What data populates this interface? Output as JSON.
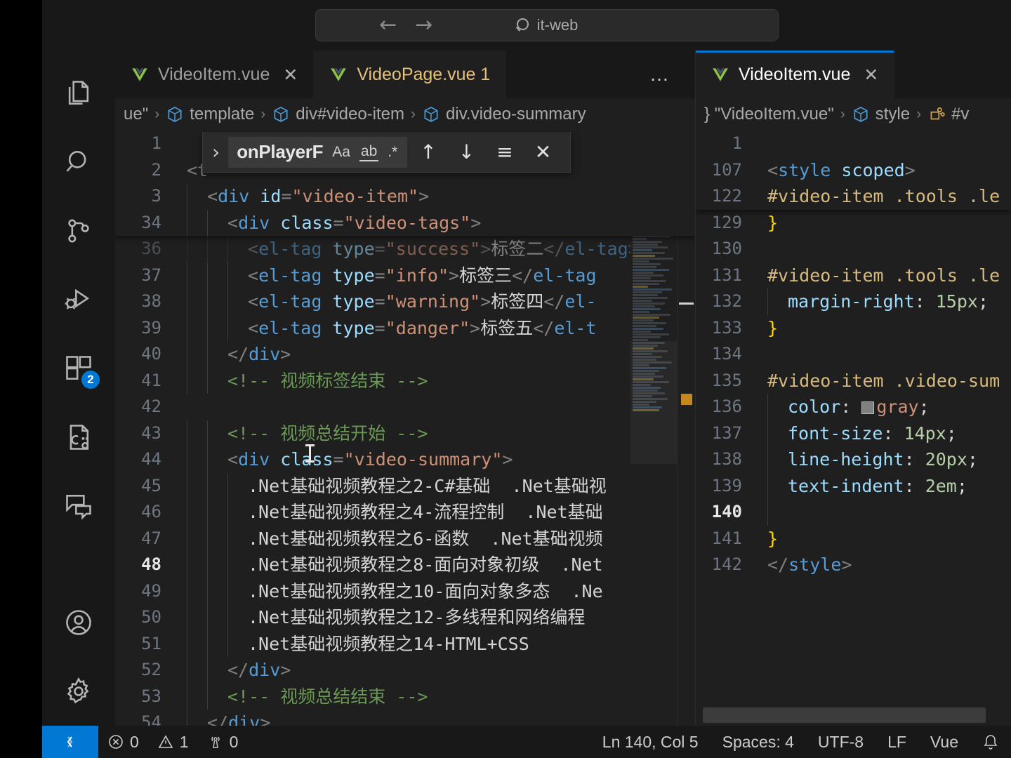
{
  "titlebar": {
    "back_icon": "arrow-left-icon",
    "forward_icon": "arrow-right-icon",
    "back_glyph": "←",
    "forward_glyph": "→",
    "search_placeholder": "it-web",
    "search_value": "it-web",
    "search_icon": "search-icon"
  },
  "activitybar": {
    "items": [
      {
        "name": "explorer",
        "icon": "files-icon",
        "badge": ""
      },
      {
        "name": "search",
        "icon": "search-icon",
        "badge": ""
      },
      {
        "name": "source-control",
        "icon": "source-control-icon",
        "badge": ""
      },
      {
        "name": "run-and-debug",
        "icon": "run-debug-icon",
        "badge": ""
      },
      {
        "name": "extensions",
        "icon": "extensions-icon",
        "badge": "2"
      },
      {
        "name": "remote-explorer",
        "icon": "cpp-config-icon",
        "badge": ""
      },
      {
        "name": "chat",
        "icon": "chat-icon",
        "badge": ""
      }
    ],
    "bottom": [
      {
        "name": "accounts",
        "icon": "account-icon"
      },
      {
        "name": "manage",
        "icon": "gear-icon"
      }
    ],
    "extensions_badge": "2"
  },
  "left_pane": {
    "tabs": [
      {
        "label": "VideoItem.vue",
        "icon": "vue-icon",
        "close": "✕",
        "active": false,
        "modified": false
      },
      {
        "label": "VideoPage.vue 1",
        "icon": "vue-icon",
        "close": "",
        "active": true,
        "modified": true
      }
    ],
    "more_actions": "…",
    "breadcrumb": [
      {
        "label": "ue\"",
        "icon": ""
      },
      {
        "label": "template",
        "icon": "symbol-cube-icon"
      },
      {
        "label": "div#video-item",
        "icon": "symbol-cube-icon"
      },
      {
        "label": "div.video-summary",
        "icon": "symbol-cube-icon"
      }
    ],
    "breadcrumb_sep": "›",
    "find": {
      "expand_icon": "chevron-right-icon",
      "query": "onPlayerF",
      "match_case_label": "Aa",
      "whole_word_label": "ab",
      "regex_label": ".*",
      "prev_glyph": "↑",
      "next_glyph": "↓",
      "find_in_selection_glyph": "≡",
      "close_glyph": "✕"
    },
    "sticky_lines": [
      {
        "num": "1",
        "indent": 0,
        "code": []
      },
      {
        "num": "2",
        "indent": 0,
        "code": [
          {
            "t": "punct",
            "s": "<t"
          }
        ]
      },
      {
        "num": "3",
        "indent": 1,
        "code": [
          {
            "t": "punct",
            "s": "<"
          },
          {
            "t": "tag",
            "s": "div"
          },
          {
            "t": "text",
            "s": " "
          },
          {
            "t": "attr",
            "s": "id"
          },
          {
            "t": "punct",
            "s": "="
          },
          {
            "t": "str",
            "s": "\"video-item\""
          },
          {
            "t": "punct",
            "s": ">"
          }
        ]
      },
      {
        "num": "34",
        "indent": 2,
        "code": [
          {
            "t": "punct",
            "s": "<"
          },
          {
            "t": "tag",
            "s": "div"
          },
          {
            "t": "text",
            "s": " "
          },
          {
            "t": "attr",
            "s": "class"
          },
          {
            "t": "punct",
            "s": "="
          },
          {
            "t": "str",
            "s": "\"video-tags\""
          },
          {
            "t": "punct",
            "s": ">"
          }
        ]
      }
    ],
    "lines": [
      {
        "num": "36",
        "indent": 3,
        "cut": true,
        "code": [
          {
            "t": "punct",
            "s": "<"
          },
          {
            "t": "tag",
            "s": "el-tag"
          },
          {
            "t": "text",
            "s": " "
          },
          {
            "t": "attr",
            "s": "type"
          },
          {
            "t": "punct",
            "s": "="
          },
          {
            "t": "str",
            "s": "\"success\""
          },
          {
            "t": "punct",
            "s": ">"
          },
          {
            "t": "text",
            "s": "标签二"
          },
          {
            "t": "punct",
            "s": "</"
          },
          {
            "t": "tag",
            "s": "el-tag"
          },
          {
            "t": "punct",
            "s": ">"
          }
        ]
      },
      {
        "num": "37",
        "indent": 3,
        "code": [
          {
            "t": "punct",
            "s": "<"
          },
          {
            "t": "tag",
            "s": "el-tag"
          },
          {
            "t": "text",
            "s": " "
          },
          {
            "t": "attr",
            "s": "type"
          },
          {
            "t": "punct",
            "s": "="
          },
          {
            "t": "str",
            "s": "\"info\""
          },
          {
            "t": "punct",
            "s": ">"
          },
          {
            "t": "text",
            "s": "标签三"
          },
          {
            "t": "punct",
            "s": "</"
          },
          {
            "t": "tag",
            "s": "el-tag"
          }
        ]
      },
      {
        "num": "38",
        "indent": 3,
        "code": [
          {
            "t": "punct",
            "s": "<"
          },
          {
            "t": "tag",
            "s": "el-tag"
          },
          {
            "t": "text",
            "s": " "
          },
          {
            "t": "attr",
            "s": "type"
          },
          {
            "t": "punct",
            "s": "="
          },
          {
            "t": "str",
            "s": "\"warning\""
          },
          {
            "t": "punct",
            "s": ">"
          },
          {
            "t": "text",
            "s": "标签四"
          },
          {
            "t": "punct",
            "s": "</"
          },
          {
            "t": "tag",
            "s": "el-"
          }
        ]
      },
      {
        "num": "39",
        "indent": 3,
        "code": [
          {
            "t": "punct",
            "s": "<"
          },
          {
            "t": "tag",
            "s": "el-tag"
          },
          {
            "t": "text",
            "s": " "
          },
          {
            "t": "attr",
            "s": "type"
          },
          {
            "t": "punct",
            "s": "="
          },
          {
            "t": "str",
            "s": "\"danger\""
          },
          {
            "t": "punct",
            "s": ">"
          },
          {
            "t": "text",
            "s": "标签五"
          },
          {
            "t": "punct",
            "s": "</"
          },
          {
            "t": "tag",
            "s": "el-t"
          }
        ]
      },
      {
        "num": "40",
        "indent": 2,
        "code": [
          {
            "t": "punct",
            "s": "</"
          },
          {
            "t": "tag",
            "s": "div"
          },
          {
            "t": "punct",
            "s": ">"
          }
        ]
      },
      {
        "num": "41",
        "indent": 2,
        "code": [
          {
            "t": "comment",
            "s": "<!-- 视频标签结束 -->"
          }
        ]
      },
      {
        "num": "42",
        "indent": 0,
        "code": []
      },
      {
        "num": "43",
        "indent": 2,
        "code": [
          {
            "t": "comment",
            "s": "<!-- 视频总结开始 -->"
          }
        ]
      },
      {
        "num": "44",
        "indent": 2,
        "code": [
          {
            "t": "punct",
            "s": "<"
          },
          {
            "t": "tag",
            "s": "div"
          },
          {
            "t": "text",
            "s": " "
          },
          {
            "t": "attr",
            "s": "class"
          },
          {
            "t": "punct",
            "s": "="
          },
          {
            "t": "str",
            "s": "\"video-summary\""
          },
          {
            "t": "punct",
            "s": ">"
          }
        ]
      },
      {
        "num": "45",
        "indent": 3,
        "code": [
          {
            "t": "text",
            "s": ".Net基础视频教程之2-C#基础  .Net基础视"
          }
        ]
      },
      {
        "num": "46",
        "indent": 3,
        "code": [
          {
            "t": "text",
            "s": ".Net基础视频教程之4-流程控制  .Net基础"
          }
        ]
      },
      {
        "num": "47",
        "indent": 3,
        "code": [
          {
            "t": "text",
            "s": ".Net基础视频教程之6-函数  .Net基础视频"
          }
        ]
      },
      {
        "num": "48",
        "indent": 3,
        "current": true,
        "code": [
          {
            "t": "text",
            "s": ".Net基础视频教程之8-面向对象初级  .Net"
          }
        ]
      },
      {
        "num": "49",
        "indent": 3,
        "code": [
          {
            "t": "text",
            "s": ".Net基础视频教程之10-面向对象多态  .Ne"
          }
        ]
      },
      {
        "num": "50",
        "indent": 3,
        "code": [
          {
            "t": "text",
            "s": ".Net基础视频教程之12-多线程和网络编程"
          }
        ]
      },
      {
        "num": "51",
        "indent": 3,
        "code": [
          {
            "t": "text",
            "s": ".Net基础视频教程之14-HTML+CSS"
          }
        ]
      },
      {
        "num": "52",
        "indent": 2,
        "code": [
          {
            "t": "punct",
            "s": "</"
          },
          {
            "t": "tag",
            "s": "div"
          },
          {
            "t": "punct",
            "s": ">"
          }
        ]
      },
      {
        "num": "53",
        "indent": 2,
        "code": [
          {
            "t": "comment",
            "s": "<!-- 视频总结结束 -->"
          }
        ]
      },
      {
        "num": "54",
        "indent": 1,
        "code": [
          {
            "t": "punct",
            "s": "</"
          },
          {
            "t": "tag",
            "s": "div"
          },
          {
            "t": "punct",
            "s": ">"
          }
        ]
      }
    ]
  },
  "right_pane": {
    "tabs": [
      {
        "label": "VideoItem.vue",
        "icon": "vue-icon",
        "close": "✕",
        "active": true,
        "modified": false
      }
    ],
    "breadcrumb": [
      {
        "label": "} \"VideoItem.vue\"",
        "icon": ""
      },
      {
        "label": "style",
        "icon": "symbol-cube-icon"
      },
      {
        "label": "#v",
        "icon": "css-rule-icon"
      }
    ],
    "breadcrumb_sep": "›",
    "sticky_lines": [
      {
        "num": "1",
        "indent": 0,
        "code": []
      },
      {
        "num": "107",
        "indent": 0,
        "code": [
          {
            "t": "punct",
            "s": "<"
          },
          {
            "t": "tag",
            "s": "style"
          },
          {
            "t": "text",
            "s": " "
          },
          {
            "t": "attr",
            "s": "scoped"
          },
          {
            "t": "punct",
            "s": ">"
          }
        ]
      },
      {
        "num": "122",
        "indent": 0,
        "code": [
          {
            "t": "sel",
            "s": "#video-item .tools .le"
          }
        ]
      }
    ],
    "lines": [
      {
        "num": "129",
        "indent": 0,
        "code": [
          {
            "t": "brace",
            "s": "}"
          }
        ]
      },
      {
        "num": "130",
        "indent": 0,
        "code": []
      },
      {
        "num": "131",
        "indent": 0,
        "code": [
          {
            "t": "sel",
            "s": "#video-item .tools .le"
          }
        ]
      },
      {
        "num": "132",
        "indent": 1,
        "code": [
          {
            "t": "prop",
            "s": "margin-right"
          },
          {
            "t": "text",
            "s": ": "
          },
          {
            "t": "num",
            "s": "15px"
          },
          {
            "t": "text",
            "s": ";"
          }
        ]
      },
      {
        "num": "133",
        "indent": 0,
        "code": [
          {
            "t": "brace",
            "s": "}"
          }
        ]
      },
      {
        "num": "134",
        "indent": 0,
        "code": []
      },
      {
        "num": "135",
        "indent": 0,
        "code": [
          {
            "t": "sel",
            "s": "#video-item .video-sum"
          }
        ]
      },
      {
        "num": "136",
        "indent": 1,
        "code": [
          {
            "t": "prop",
            "s": "color"
          },
          {
            "t": "text",
            "s": ": "
          },
          {
            "t": "swatch",
            "s": ""
          },
          {
            "t": "val",
            "s": "gray"
          },
          {
            "t": "text",
            "s": ";"
          }
        ]
      },
      {
        "num": "137",
        "indent": 1,
        "code": [
          {
            "t": "prop",
            "s": "font-size"
          },
          {
            "t": "text",
            "s": ": "
          },
          {
            "t": "num",
            "s": "14px"
          },
          {
            "t": "text",
            "s": ";"
          }
        ]
      },
      {
        "num": "138",
        "indent": 1,
        "code": [
          {
            "t": "prop",
            "s": "line-height"
          },
          {
            "t": "text",
            "s": ": "
          },
          {
            "t": "num",
            "s": "20px"
          },
          {
            "t": "text",
            "s": ";"
          }
        ]
      },
      {
        "num": "139",
        "indent": 1,
        "code": [
          {
            "t": "prop",
            "s": "text-indent"
          },
          {
            "t": "text",
            "s": ": "
          },
          {
            "t": "num",
            "s": "2em"
          },
          {
            "t": "text",
            "s": ";"
          }
        ]
      },
      {
        "num": "140",
        "indent": 1,
        "current": true,
        "code": []
      },
      {
        "num": "141",
        "indent": 0,
        "code": [
          {
            "t": "brace",
            "s": "}"
          }
        ]
      },
      {
        "num": "142",
        "indent": 0,
        "code": [
          {
            "t": "punct",
            "s": "</"
          },
          {
            "t": "tag",
            "s": "style"
          },
          {
            "t": "punct",
            "s": ">"
          }
        ]
      }
    ]
  },
  "statusbar": {
    "remote_icon": "remote-window-icon",
    "errors_icon": "error-icon",
    "errors": "0",
    "warnings_icon": "warning-icon",
    "warnings": "1",
    "ports_icon": "radio-tower-icon",
    "ports": "0",
    "cursor_position": "Ln 140, Col 5",
    "indentation": "Spaces: 4",
    "encoding": "UTF-8",
    "eol": "LF",
    "language": "Vue",
    "notifications_icon": "bell-icon"
  },
  "colors": {
    "accent": "#0078d4",
    "editor_bg": "#1f1f1f",
    "chrome_bg": "#181818",
    "modified_tab": "#e5c07b",
    "comment": "#6a9955",
    "string": "#ce9178",
    "tag": "#569cd6"
  }
}
